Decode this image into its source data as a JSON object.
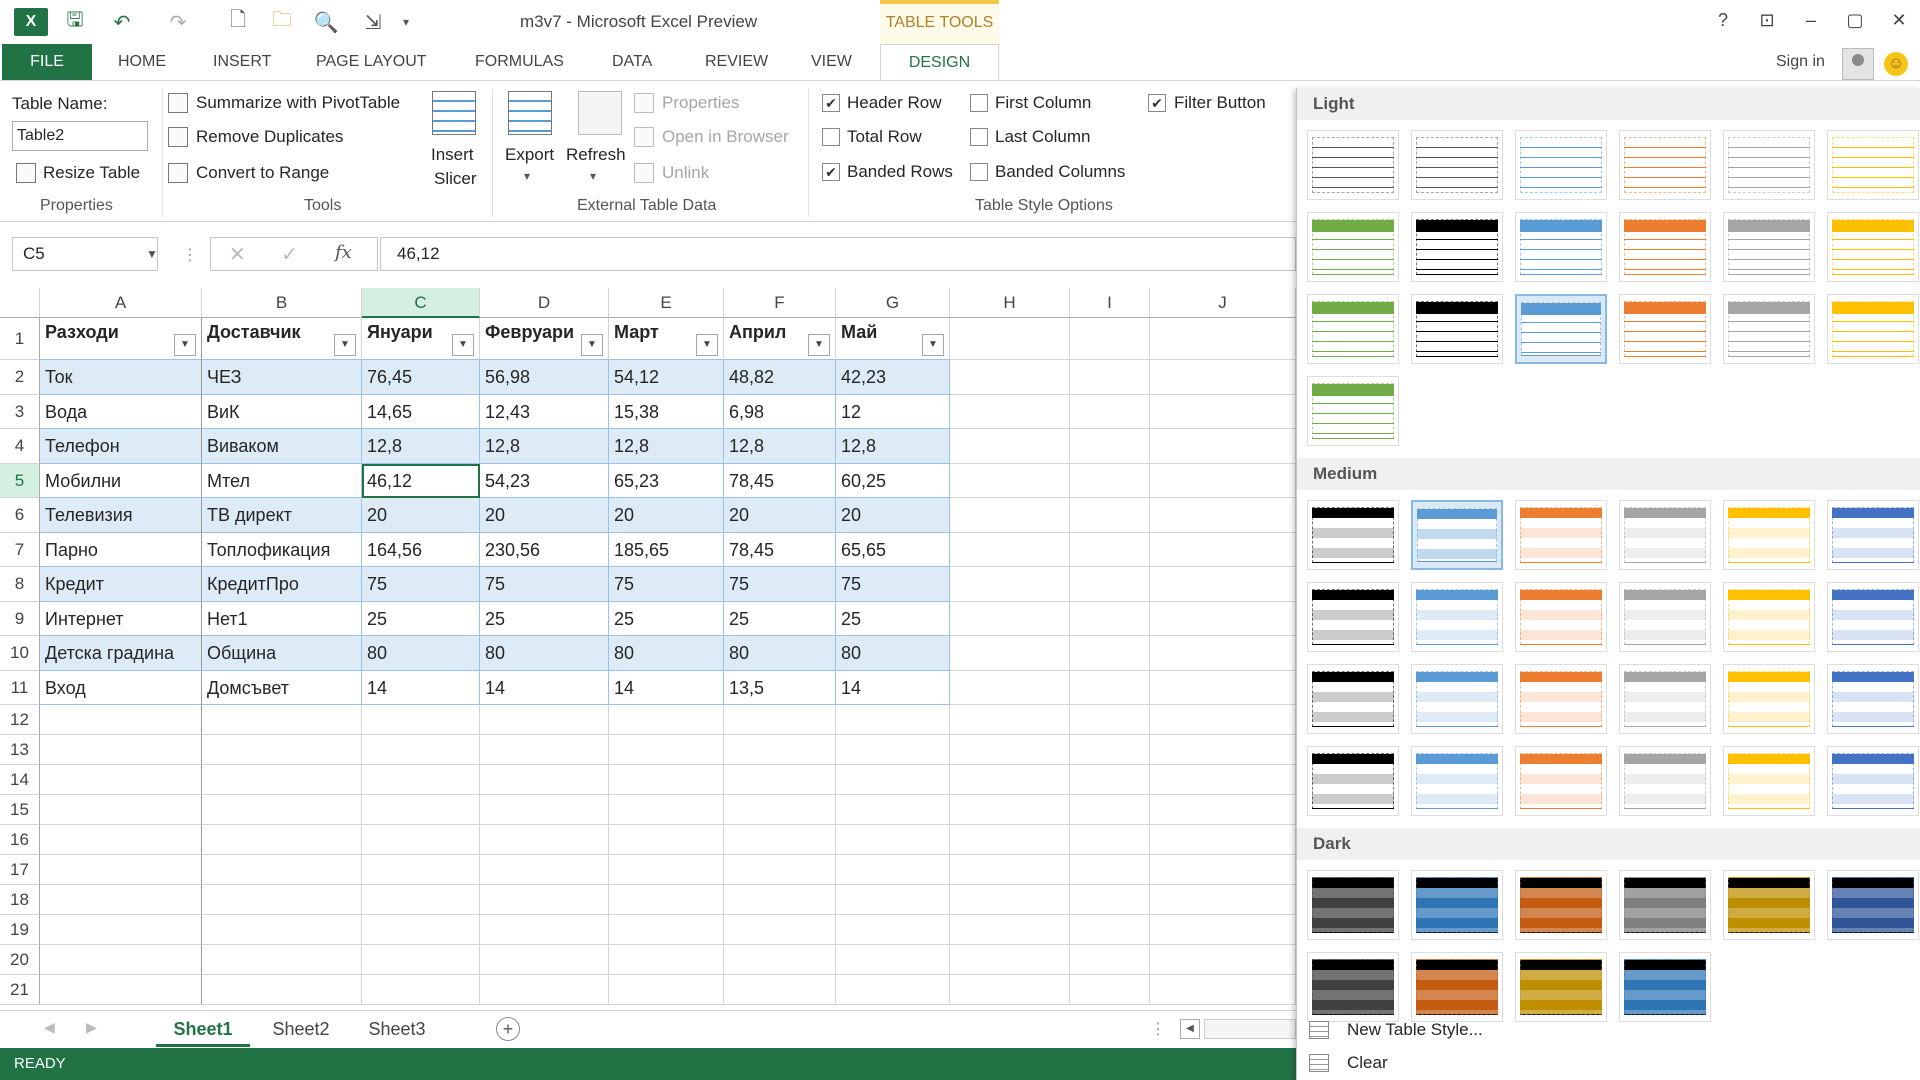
{
  "window": {
    "title": "m3v7 - Microsoft Excel Preview",
    "context_tab": "TABLE TOOLS"
  },
  "ribbon_tabs": [
    "FILE",
    "HOME",
    "INSERT",
    "PAGE LAYOUT",
    "FORMULAS",
    "DATA",
    "REVIEW",
    "VIEW",
    "DESIGN"
  ],
  "active_tab": "DESIGN",
  "account": {
    "sign_in": "Sign in"
  },
  "properties": {
    "table_name_label": "Table Name:",
    "table_name_value": "Table2",
    "resize": "Resize Table",
    "group": "Properties"
  },
  "tools": {
    "pivot": "Summarize with PivotTable",
    "remove_dupes": "Remove Duplicates",
    "convert": "Convert to Range",
    "insert_slicer_1": "Insert",
    "insert_slicer_2": "Slicer",
    "group": "Tools"
  },
  "external": {
    "export": "Export",
    "refresh": "Refresh",
    "properties": "Properties",
    "open_browser": "Open in Browser",
    "unlink": "Unlink",
    "group": "External Table Data"
  },
  "style_options": {
    "header_row": {
      "label": "Header Row",
      "checked": true
    },
    "total_row": {
      "label": "Total Row",
      "checked": false
    },
    "banded_rows": {
      "label": "Banded Rows",
      "checked": true
    },
    "first_column": {
      "label": "First Column",
      "checked": false
    },
    "last_column": {
      "label": "Last Column",
      "checked": false
    },
    "banded_columns": {
      "label": "Banded Columns",
      "checked": false
    },
    "filter_button": {
      "label": "Filter Button",
      "checked": true
    },
    "group": "Table Style Options"
  },
  "formula_bar": {
    "name_box": "C5",
    "fx": "fx",
    "value": "46,12"
  },
  "columns": [
    "A",
    "B",
    "C",
    "D",
    "E",
    "F",
    "G",
    "H",
    "I",
    "J"
  ],
  "rows": [
    "1",
    "2",
    "3",
    "4",
    "5",
    "6",
    "7",
    "8",
    "9",
    "10",
    "11",
    "12",
    "13",
    "14",
    "15",
    "16",
    "17",
    "18",
    "19",
    "20",
    "21"
  ],
  "table": {
    "headers": [
      "Разходи",
      "Доставчик",
      "Януари",
      "Февруари",
      "Март",
      "Април",
      "Май"
    ],
    "data": [
      [
        "Ток",
        "ЧЕЗ",
        "76,45",
        "56,98",
        "54,12",
        "48,82",
        "42,23"
      ],
      [
        "Вода",
        "ВиК",
        "14,65",
        "12,43",
        "15,38",
        "6,98",
        "12"
      ],
      [
        "Телефон",
        "Виваком",
        "12,8",
        "12,8",
        "12,8",
        "12,8",
        "12,8"
      ],
      [
        "Мобилни",
        "Мтел",
        "46,12",
        "54,23",
        "65,23",
        "78,45",
        "60,25"
      ],
      [
        "Телевизия",
        "ТВ директ",
        "20",
        "20",
        "20",
        "20",
        "20"
      ],
      [
        "Парно",
        "Топлофикация",
        "164,56",
        "230,56",
        "185,65",
        "78,45",
        "65,65"
      ],
      [
        "Кредит",
        "КредитПро",
        "75",
        "75",
        "75",
        "75",
        "75"
      ],
      [
        "Интернет",
        "Нет1",
        "25",
        "25",
        "25",
        "25",
        "25"
      ],
      [
        "Детска градина",
        "Община",
        "80",
        "80",
        "80",
        "80",
        "80"
      ],
      [
        "Вход",
        "Домсъвет",
        "14",
        "14",
        "14",
        "13,5",
        "14"
      ]
    ]
  },
  "sheets": [
    "Sheet1",
    "Sheet2",
    "Sheet3"
  ],
  "active_sheet": "Sheet1",
  "status": "READY",
  "gallery": {
    "sections": [
      "Light",
      "Medium",
      "Dark"
    ],
    "new_style": "New Table Style...",
    "clear": "Clear",
    "light_colors": [
      "#555555",
      "#5b9bd5",
      "#ed7d31",
      "#a5a5a5",
      "#ffc000",
      "#70ad47",
      "#000000",
      "#4472c4"
    ],
    "medium_colors": [
      "#000000",
      "#5b9bd5",
      "#ed7d31",
      "#a5a5a5",
      "#ffc000",
      "#4472c4"
    ],
    "dark_colors": [
      "#404040",
      "#2e75b6",
      "#c55a11",
      "#7f7f7f",
      "#bf8f00",
      "#2f5597"
    ]
  },
  "colors": {
    "excel_green": "#217346",
    "band_blue": "#ddebf7",
    "band_border": "#9bc2e6"
  }
}
